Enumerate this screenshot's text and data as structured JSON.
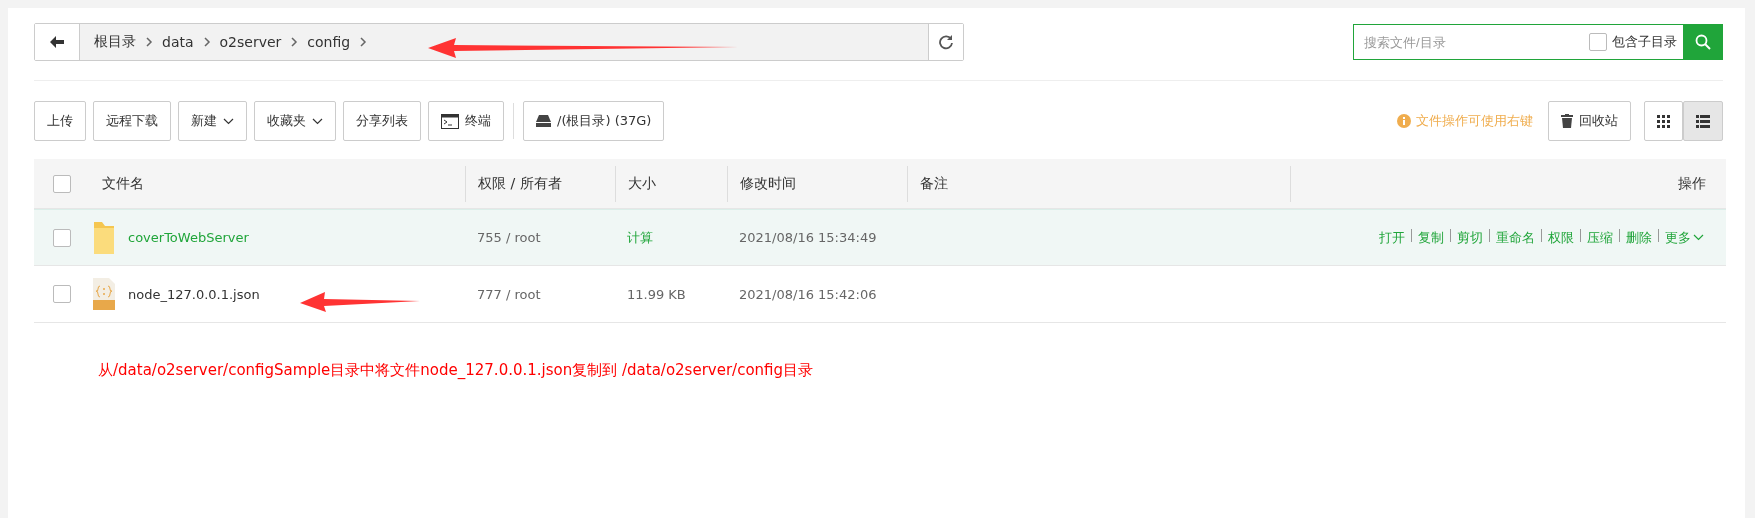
{
  "breadcrumb": {
    "items": [
      "根目录",
      "data",
      "o2server",
      "config"
    ]
  },
  "search": {
    "placeholder": "搜索文件/目录",
    "include_subdirs": {
      "label": "包含子目录",
      "checked": false
    }
  },
  "toolbar": {
    "buttons": [
      {
        "label": "上传",
        "kind": "plain"
      },
      {
        "label": "远程下载",
        "kind": "plain"
      },
      {
        "label": "新建",
        "kind": "menu"
      },
      {
        "label": "收藏夹",
        "kind": "menu"
      },
      {
        "label": "分享列表",
        "kind": "plain"
      },
      {
        "label": "终端",
        "kind": "terminal"
      }
    ],
    "disk": "/(根目录) (37G)",
    "hint": "文件操作可使用右键",
    "recycle": "回收站",
    "views": [
      {
        "kind": "grid",
        "selected": false
      },
      {
        "kind": "list",
        "selected": true
      }
    ]
  },
  "table": {
    "select_all_checked": false,
    "columns": [
      "文件名",
      "权限 / 所有者",
      "大小",
      "修改时间",
      "备注",
      "操作"
    ],
    "rows": [
      {
        "kind": "folder",
        "name": "coverToWebServer",
        "perms": "755 / root",
        "size": "计算",
        "modified": "2021/08/16 15:34:49",
        "checked": false,
        "highlighted": true,
        "actions": [
          "打开",
          "复制",
          "剪切",
          "重命名",
          "权限",
          "压缩",
          "删除",
          "更多"
        ]
      },
      {
        "kind": "json",
        "name": "node_127.0.0.1.json",
        "perms": "777 / root",
        "size": "11.99 KB",
        "modified": "2021/08/16 15:42:06",
        "checked": false,
        "highlighted": false
      }
    ]
  },
  "annotation": "从/data/o2server/configSample目录中将文件node_127.0.0.1.json复制到 /data/o2server/config目录"
}
